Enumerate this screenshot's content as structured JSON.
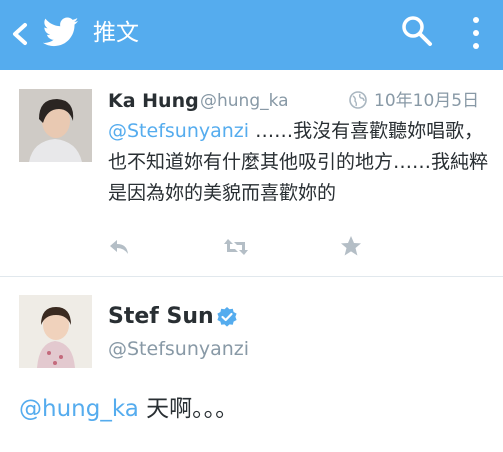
{
  "colors": {
    "brand": "#55acee",
    "handle_gray": "#8899a6",
    "text": "#292f33"
  },
  "topbar": {
    "title": "推文",
    "back_icon": "chevron-left-icon",
    "logo_icon": "twitter-bird-icon",
    "search_icon": "search-icon",
    "more_icon": "more-vertical-icon"
  },
  "tweet1": {
    "name": "Ka Hung",
    "handle": "@hung_ka",
    "date": "10年10月5日",
    "mention": "@Stefsunyanzi",
    "body": " ……我沒有喜歡聽妳唱歌，也不知道妳有什麼其他吸引的地方……我純粹是因為妳的美貌而喜歡妳的",
    "actions": [
      "reply-icon",
      "retweet-icon",
      "favorite-star-icon"
    ]
  },
  "tweet2": {
    "name": "Stef Sun",
    "verified_icon": "verified-badge-icon",
    "handle": "@Stefsunyanzi",
    "mention": "@hung_ka",
    "body": " 天啊。。。"
  }
}
